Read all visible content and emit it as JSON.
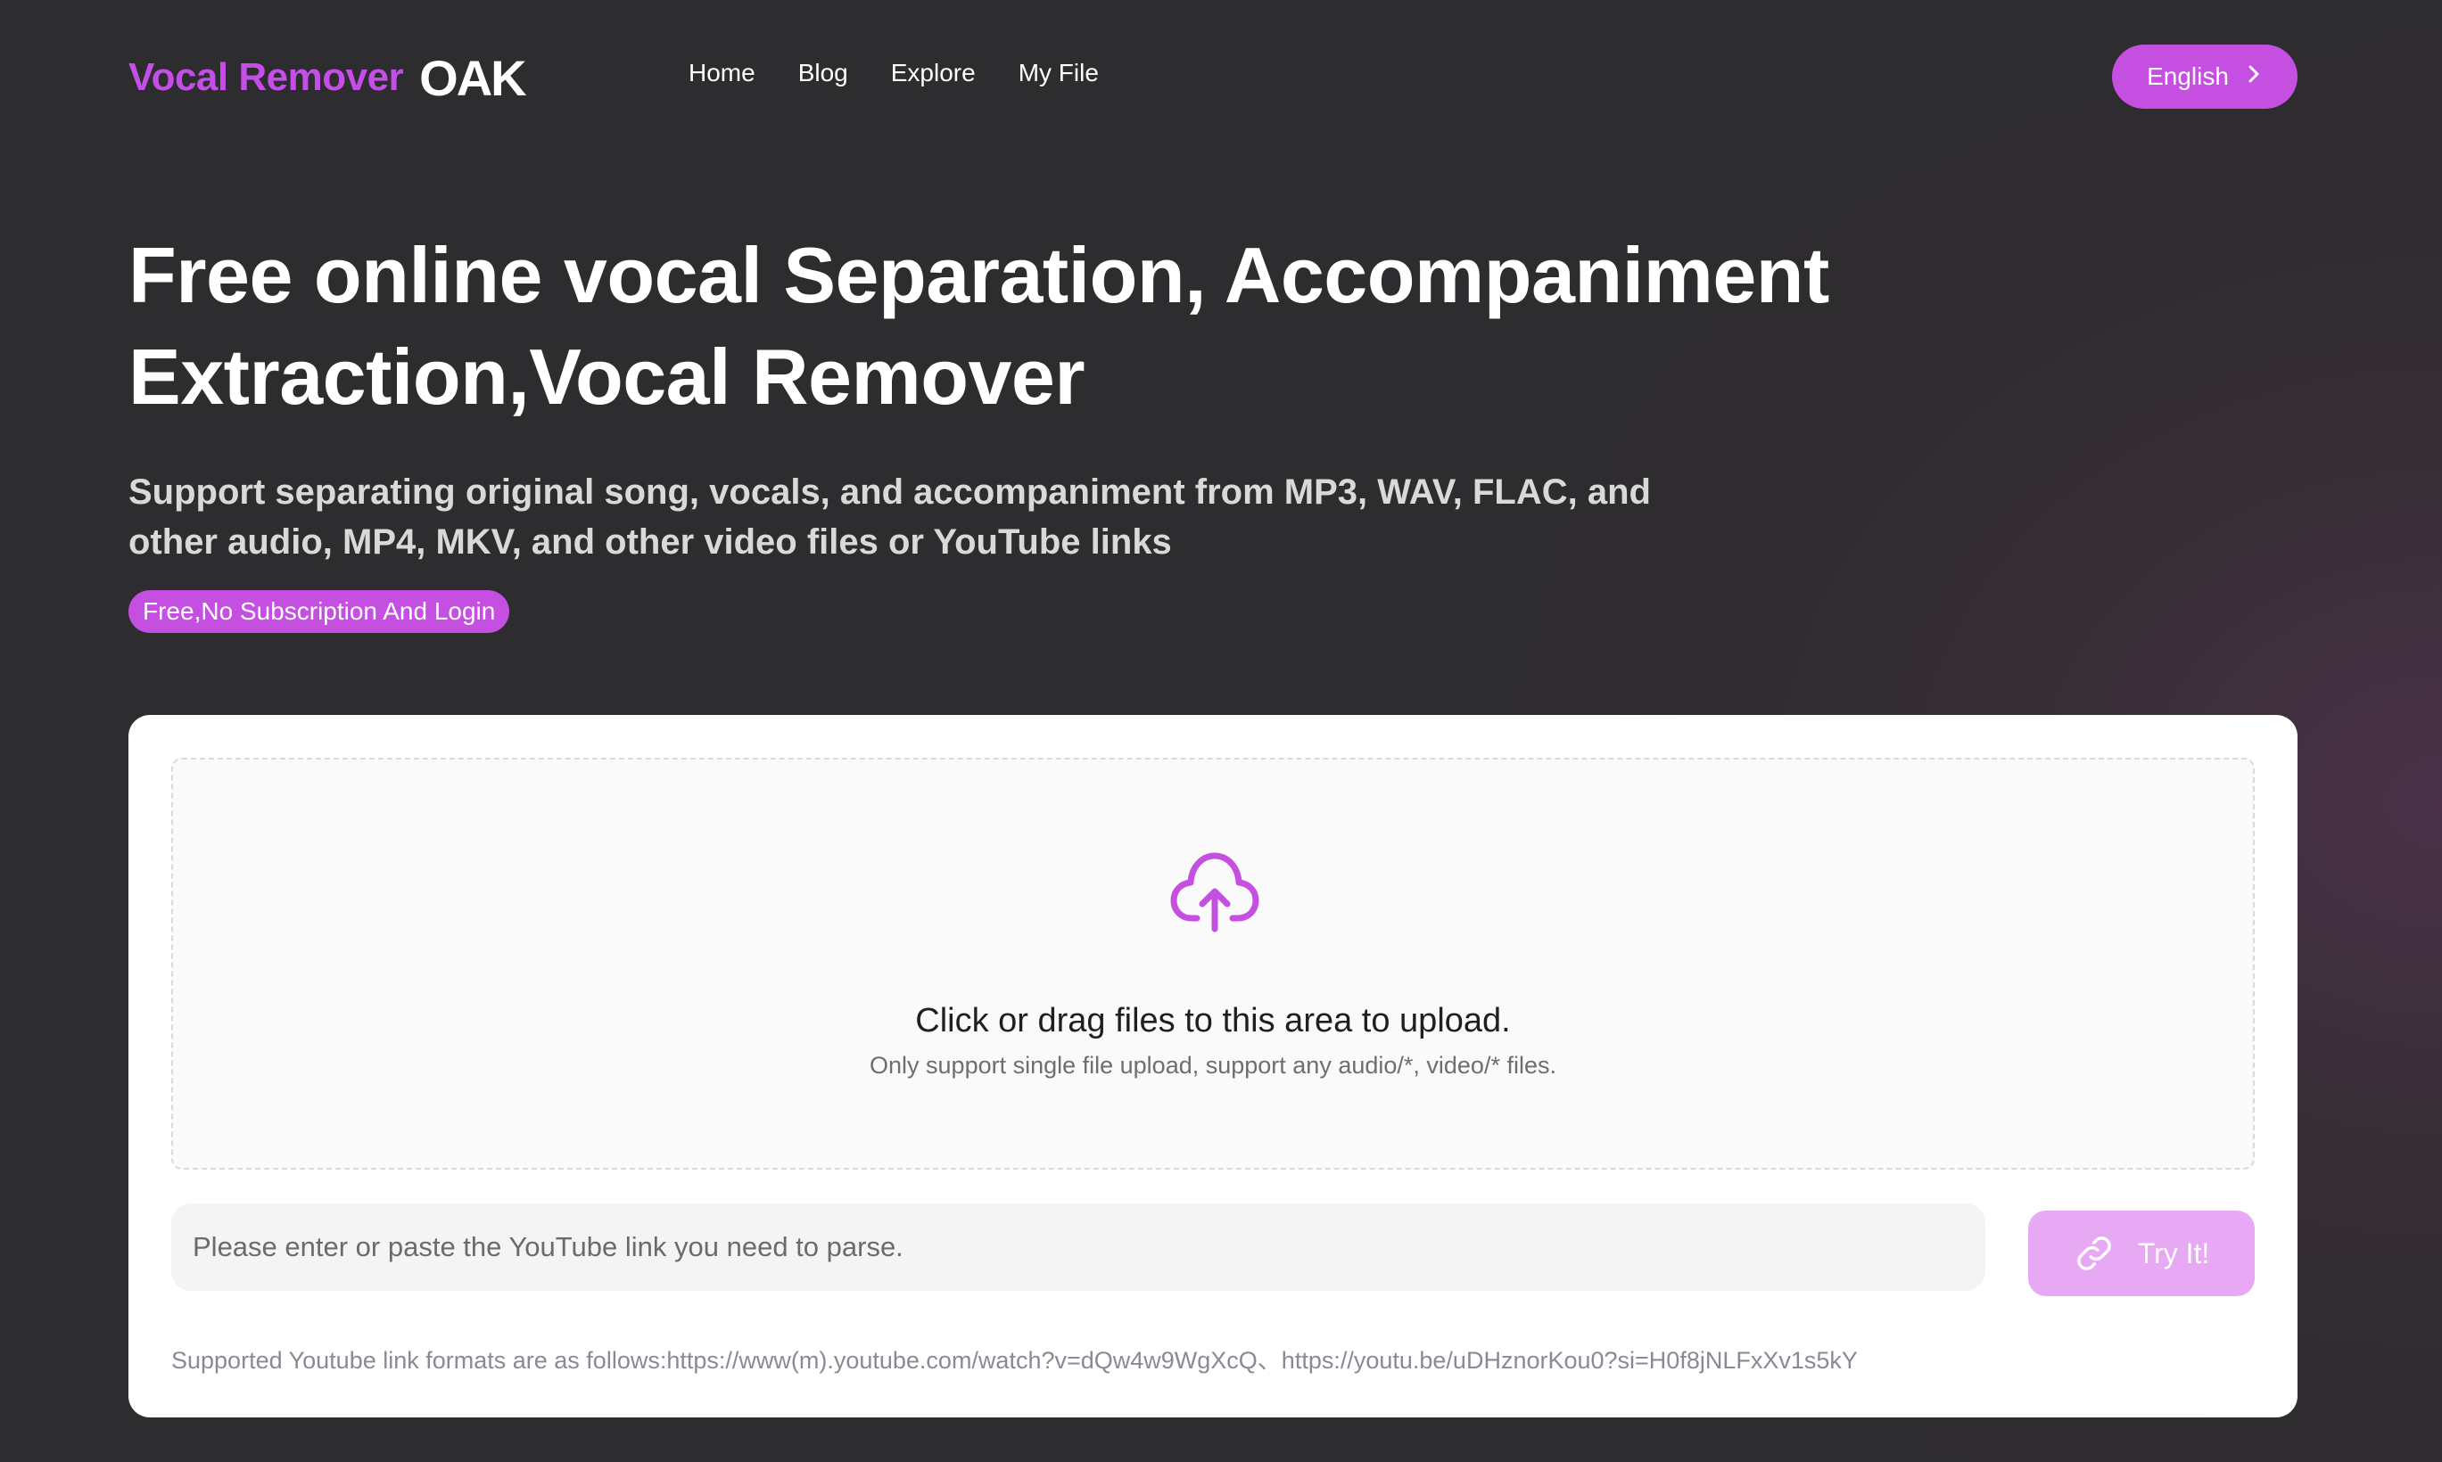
{
  "header": {
    "logo_text": "Vocal Remover",
    "logo_mark": "OAK",
    "nav": [
      "Home",
      "Blog",
      "Explore",
      "My File"
    ],
    "language_button": "English",
    "language_chevron_icon": "chevron-right-icon"
  },
  "hero": {
    "title_line1": "Free online vocal Separation, Accompaniment",
    "title_line2": "Extraction,Vocal Remover",
    "subtitle_line1": "Support separating original song, vocals, and accompaniment from MP3, WAV, FLAC, and",
    "subtitle_line2": "other audio, MP4, MKV, and other video files or YouTube links",
    "badge": "Free,No Subscription And Login"
  },
  "upload": {
    "icon": "cloud-upload-icon",
    "title": "Click or drag files to this area to upload.",
    "hint": "Only support single file upload, support any audio/*, video/* files."
  },
  "link": {
    "placeholder": "Please enter or paste the YouTube link you need to parse.",
    "value": "",
    "button_label": "Try It!",
    "button_icon": "link-icon",
    "formats_note": "Supported Youtube link formats are as follows:https://www(m).youtube.com/watch?v=dQw4w9WgXcQ、https://youtu.be/uDHznorKou0?si=H0f8jNLFxXv1s5kY"
  },
  "colors": {
    "accent": "#c44fe0",
    "button_disabled": "#e7a9f4",
    "background": "#2d2c2e",
    "card": "#ffffff"
  }
}
